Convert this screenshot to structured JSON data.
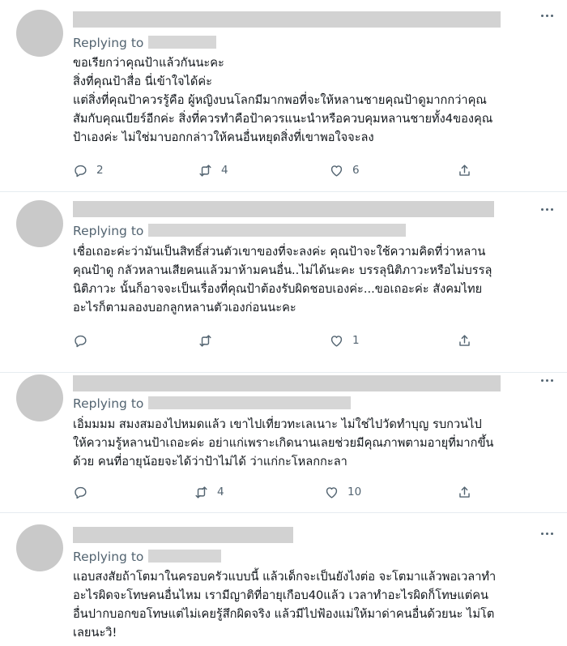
{
  "replying_to_label": "Replying to",
  "tweets": [
    {
      "lines": [
        "ขอเรียกว่าคุณป้าแล้วกันนะคะ",
        "สิ่งที่คุณป้าสื่อ นี่เข้าใจได้ค่ะ",
        "แต่สิ่งที่คุณป้าควรรู้คือ ผู้หญิงบนโลกมีมากพอที่จะให้หลานชายคุณป้าดูมากกว่าคุณ",
        "สัมกับคุณเบียร์อีกค่ะ สิ่งที่ควรทำคือป้าควรแนะนำหรือควบคุมหลานชายทั้ง4ของคุณ",
        "ป้าเองค่ะ ไม่ใช่มาบอกกล่าวให้คนอื่นหยุดสิ่งที่เขาพอใจจะลง"
      ],
      "replies": "2",
      "retweets": "4",
      "likes": "6"
    },
    {
      "lines": [
        "เชื่อเถอะค่ะว่ามันเป็นสิทธิ์ส่วนตัวเขาของที่จะลงค่ะ คุณป้าจะใช้ความคิดที่ว่าหลาน",
        "คุณป้าดู กลัวหลานเสียคนแล้วมาห้ามคนอื่น..ไม่ได้นะคะ บรรลุนิติภาวะหรือไม่บรรลุ",
        "นิติภาวะ นั้นก็อาจจะเป็นเรื่องที่คุณป้าต้องรับผิดชอบเองค่ะ...ขอเถอะค่ะ สังคมไทย",
        "อะไรก็ตามลองบอกลูกหลานตัวเองก่อนนะคะ"
      ],
      "replies": "",
      "retweets": "",
      "likes": "1"
    },
    {
      "lines": [
        "เอิ่มมมม สมงสมองไปหมดแล้ว เขาไปเที่ยวทะเลเนาะ ไม่ใช่ไปวัดทำบุญ รบกวนไป",
        "ให้ความรู้หลานป้าเถอะค่ะ อย่าแก่เพราะเกิดนานเลยช่วยมีคุณภาพตามอายุที่มากขึ้น",
        "ด้วย คนที่อายุน้อยจะได้ว่าป้าไม่ได้ ว่าแก่กะโหลกกะลา"
      ],
      "replies": "",
      "retweets": "4",
      "likes": "10"
    },
    {
      "lines": [
        "แอบสงสัยถ้าโตมาในครอบครัวแบบนี้ แล้วเด็กจะเป็นยังไงต่อ จะโตมาแล้วพอเวลาทำ",
        "อะไรผิดจะโทษคนอื่นไหม เรามีญาติที่อายุเกือบ40แล้ว เวลาทำอะไรผิดก็โทษแต่คน",
        "อื่นปากบอกขอโทษแต่ไม่เคยรู้สึกผิดจริง แล้วมีไปฟ้องแม่ให้มาด่าคนอื่นด้วยนะ ไม่โต",
        "เลยนะวิ!"
      ]
    }
  ],
  "icons": {
    "reply": "reply-icon",
    "retweet": "retweet-icon",
    "like": "heart-icon",
    "share": "share-icon",
    "more": "more-icon"
  }
}
